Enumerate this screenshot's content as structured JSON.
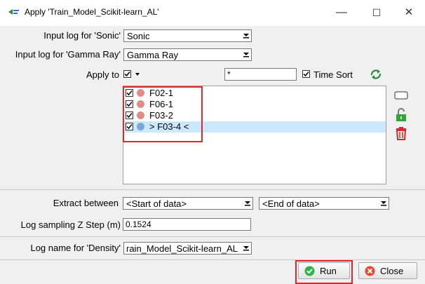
{
  "window": {
    "title": "Apply 'Train_Model_Scikit-learn_AL'",
    "minimize": "—",
    "maximize": "☐",
    "close": "✕"
  },
  "inputs": [
    {
      "label": "Input log for 'Sonic'",
      "value": "Sonic"
    },
    {
      "label": "Input log for 'Gamma Ray'",
      "value": "Gamma Ray"
    }
  ],
  "apply_to": {
    "label": "Apply to",
    "filter_value": "*",
    "time_sort_label": "Time Sort",
    "wells": [
      {
        "name": "F02-1",
        "checked": true,
        "color": "#e08c8c"
      },
      {
        "name": "F06-1",
        "checked": true,
        "color": "#e08c8c"
      },
      {
        "name": "F03-2",
        "checked": true,
        "color": "#e08c8c"
      },
      {
        "name": "> F03-4 <",
        "checked": true,
        "color": "#7aa6d8",
        "selected": true
      }
    ]
  },
  "extract": {
    "label": "Extract between",
    "start": "<Start of data>",
    "end": "<End of data>"
  },
  "sampling": {
    "label": "Log sampling Z Step (m)",
    "value": "0.1524"
  },
  "output": {
    "label": "Log name for 'Density'",
    "value": "rain_Model_Scikit-learn_AL"
  },
  "buttons": {
    "run": "Run",
    "close": "Close"
  },
  "colors": {
    "highlight": "#e3262a",
    "selection": "#cce8ff",
    "run_icon": "#2db34a",
    "close_icon": "#e54b2a"
  }
}
